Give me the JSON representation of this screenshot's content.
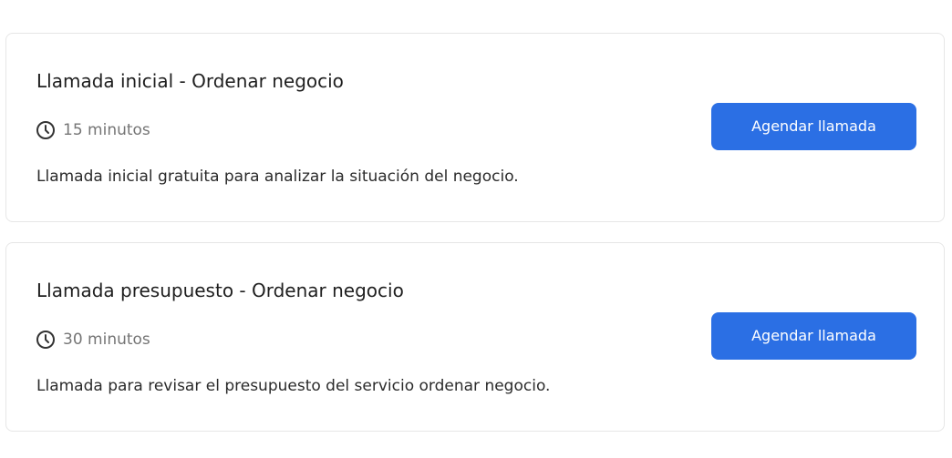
{
  "colors": {
    "accent": "#2b6fe4",
    "card_border": "#e6e6e6",
    "muted_text": "#757575"
  },
  "cards": [
    {
      "title": "Llamada inicial - Ordenar negocio",
      "duration_icon": "clock-icon",
      "duration": "15 minutos",
      "description": "Llamada inicial gratuita para analizar la situación del negocio.",
      "button_label": "Agendar llamada"
    },
    {
      "title": "Llamada presupuesto - Ordenar negocio",
      "duration_icon": "clock-icon",
      "duration": "30 minutos",
      "description": "Llamada para revisar el presupuesto del servicio ordenar negocio.",
      "button_label": "Agendar llamada"
    }
  ]
}
